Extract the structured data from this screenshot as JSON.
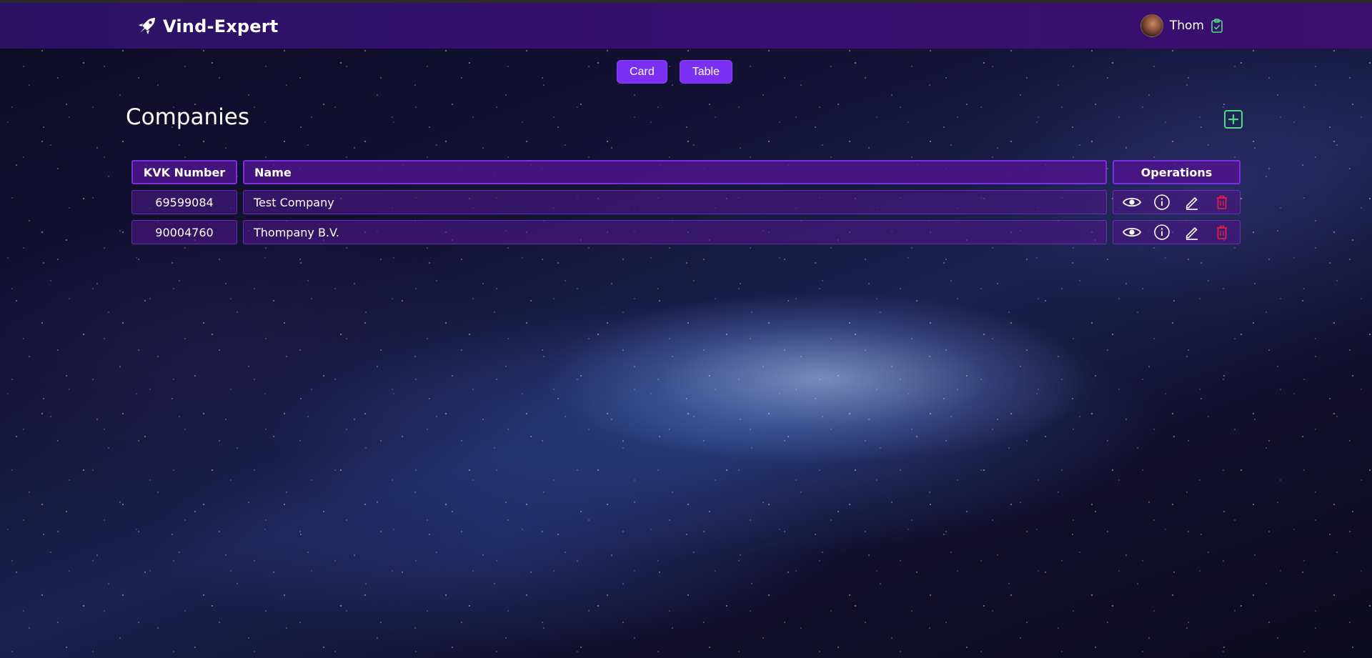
{
  "brand": {
    "name": "Vind-Expert"
  },
  "user": {
    "name": "Thom"
  },
  "view_toggle": {
    "card_label": "Card",
    "table_label": "Table"
  },
  "page": {
    "title": "Companies"
  },
  "table": {
    "headers": {
      "kvk": "KVK Number",
      "name": "Name",
      "operations": "Operations"
    },
    "rows": [
      {
        "kvk": "69599084",
        "name": "Test Company"
      },
      {
        "kvk": "90004760",
        "name": "Thompany B.V."
      }
    ]
  },
  "icons": {
    "brand": "rocket-icon",
    "user": "clipboard-check-icon",
    "add": "plus-square-icon",
    "view": "eye-icon",
    "info": "info-icon",
    "edit": "pencil-icon",
    "delete": "trash-icon"
  },
  "colors": {
    "navbar": "#35106e",
    "accent": "#7b2ff2",
    "add_icon": "#4ade80",
    "delete_icon": "#e11d48",
    "clipboard_icon": "#4ade80"
  }
}
